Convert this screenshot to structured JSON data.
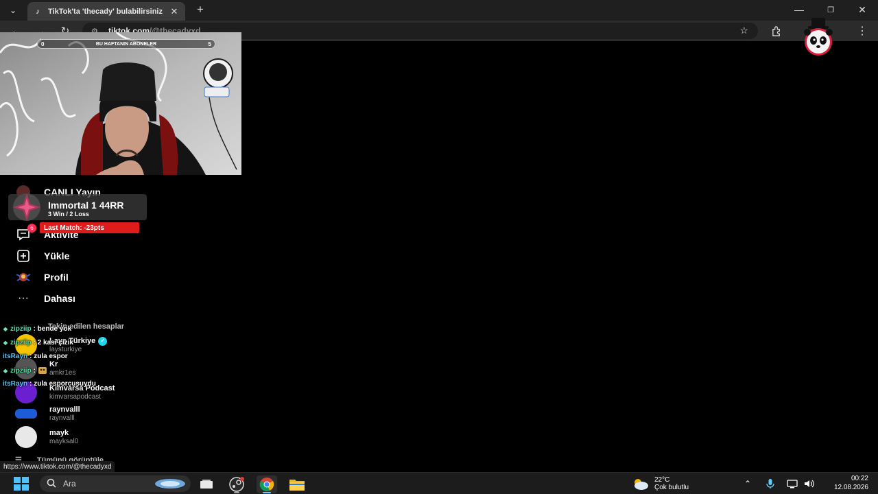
{
  "browser": {
    "tab_title": "TikTok'ta 'thecady' bulabilirsiniz",
    "tab_favicon": "tiktok-icon",
    "url_host": "tiktok.com",
    "url_path": "/@thecadyxd",
    "status_url": "https://www.tiktok.com/@thecadyxd"
  },
  "sidebar": {
    "items": [
      {
        "label": "CANLI Yayın",
        "icon": "live-icon"
      },
      {
        "label": "Aktivite",
        "icon": "message-icon",
        "badge": "6"
      },
      {
        "label": "Yükle",
        "icon": "upload-icon"
      },
      {
        "label": "Profil",
        "icon": "profile-avatar"
      },
      {
        "label": "Dahası",
        "icon": "more-icon"
      }
    ],
    "following_header": "Takip edilen hesaplar",
    "accounts": [
      {
        "name": "Lays Türkiye",
        "handle": "laysturkiye",
        "verified": true,
        "color": "#f5c400"
      },
      {
        "name": "Kr",
        "handle": "amkr1es",
        "verified": false,
        "color": "#888888"
      },
      {
        "name": "Kimvarsa Podcast",
        "handle": "kimvarsapodcast",
        "verified": false,
        "color": "#6a1fd1"
      },
      {
        "name": "raynvalll",
        "handle": "raynvalll",
        "verified": false,
        "color": "#1e5bd6"
      },
      {
        "name": "mayk",
        "handle": "mayksal0",
        "verified": false,
        "color": "#cfcfcf"
      }
    ],
    "view_all": "Tümünü görüntüle"
  },
  "stream": {
    "subs_bar": {
      "left": "0",
      "label": "BU HAFTANIN ABONELER",
      "right": "5"
    },
    "rank": {
      "title": "Immortal 1  44RR",
      "record": "3 Win / 2 Loss",
      "last_match": "Last Match: -23pts"
    },
    "chat": [
      {
        "user": "zipziip",
        "message": ": bende yok",
        "color": "green"
      },
      {
        "user": "zipziip",
        "message": ": 2 kası çizik",
        "color": "green"
      },
      {
        "user": "itsRayn",
        "message": ": zula espor",
        "color": "blue"
      },
      {
        "user": "zipziip",
        "message": ":",
        "color": "green",
        "emote": true
      },
      {
        "user": "itsRayn",
        "message": ": zula esporcusuydu",
        "color": "blue"
      }
    ]
  },
  "taskbar": {
    "search_placeholder": "Ara",
    "weather_temp": "22°C",
    "weather_desc": "Çok bulutlu",
    "time": "00:22",
    "date": "12.08.2026"
  },
  "colors": {
    "accent_red": "#fe2c55",
    "rank_red": "#e01b1b",
    "chat_green": "#4fe0a9",
    "chat_blue": "#4fc3f7"
  }
}
